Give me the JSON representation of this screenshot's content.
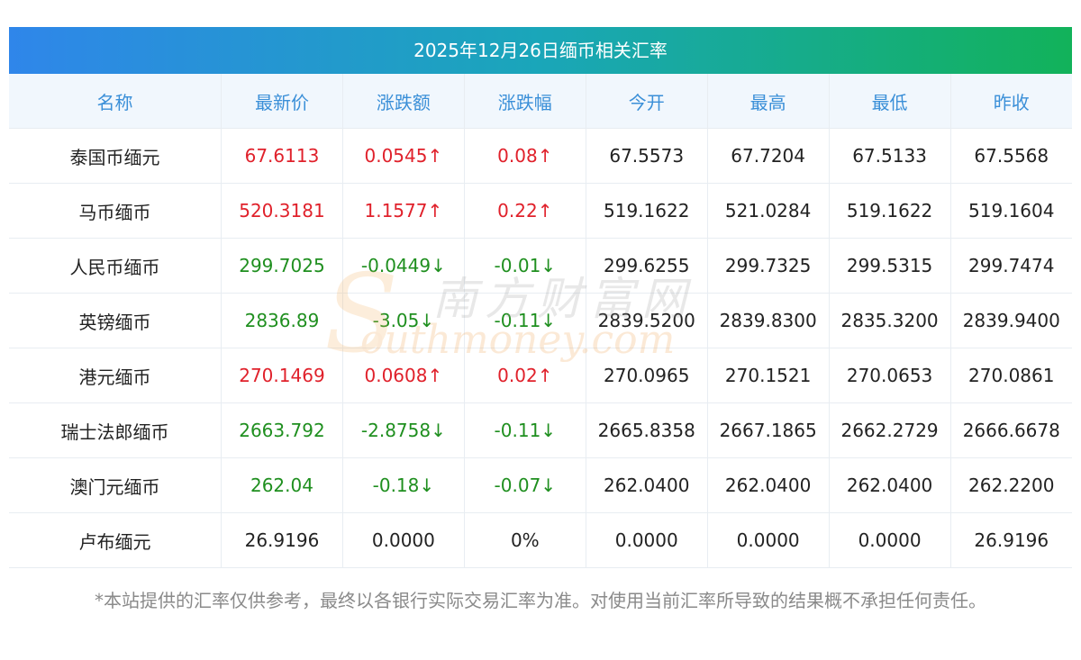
{
  "title": "2025年12月26日缅币相关汇率",
  "columns": [
    "名称",
    "最新价",
    "涨跌额",
    "涨跌幅",
    "今开",
    "最高",
    "最低",
    "昨收"
  ],
  "rows": [
    {
      "name": "泰国币缅元",
      "latest": "67.6113",
      "change": "0.0545↑",
      "pct": "0.08↑",
      "open": "67.5573",
      "high": "67.7204",
      "low": "67.5133",
      "prev": "67.5568",
      "trend": "up"
    },
    {
      "name": "马币缅币",
      "latest": "520.3181",
      "change": "1.1577↑",
      "pct": "0.22↑",
      "open": "519.1622",
      "high": "521.0284",
      "low": "519.1622",
      "prev": "519.1604",
      "trend": "up"
    },
    {
      "name": "人民币缅币",
      "latest": "299.7025",
      "change": "-0.0449↓",
      "pct": "-0.01↓",
      "open": "299.6255",
      "high": "299.7325",
      "low": "299.5315",
      "prev": "299.7474",
      "trend": "down"
    },
    {
      "name": "英镑缅币",
      "latest": "2836.89",
      "change": "-3.05↓",
      "pct": "-0.11↓",
      "open": "2839.5200",
      "high": "2839.8300",
      "low": "2835.3200",
      "prev": "2839.9400",
      "trend": "down"
    },
    {
      "name": "港元缅币",
      "latest": "270.1469",
      "change": "0.0608↑",
      "pct": "0.02↑",
      "open": "270.0965",
      "high": "270.1521",
      "low": "270.0653",
      "prev": "270.0861",
      "trend": "up"
    },
    {
      "name": "瑞士法郎缅币",
      "latest": "2663.792",
      "change": "-2.8758↓",
      "pct": "-0.11↓",
      "open": "2665.8358",
      "high": "2667.1865",
      "low": "2662.2729",
      "prev": "2666.6678",
      "trend": "down"
    },
    {
      "name": "澳门元缅币",
      "latest": "262.04",
      "change": "-0.18↓",
      "pct": "-0.07↓",
      "open": "262.0400",
      "high": "262.0400",
      "low": "262.0400",
      "prev": "262.2200",
      "trend": "down"
    },
    {
      "name": "卢布缅元",
      "latest": "26.9196",
      "change": "0.0000",
      "pct": "0%",
      "open": "0.0000",
      "high": "0.0000",
      "low": "0.0000",
      "prev": "26.9196",
      "trend": "flat"
    }
  ],
  "watermark": {
    "cn": "南方财富网",
    "en": "outhmoney.com",
    "logo_letter": "S"
  },
  "disclaimer": "*本站提供的汇率仅供参考，最终以各银行实际交易汇率为准。对使用当前汇率所导致的结果概不承担任何责任。",
  "colors": {
    "up": "#e0212b",
    "down": "#1f8f1f",
    "header_text": "#3a8fd8"
  }
}
